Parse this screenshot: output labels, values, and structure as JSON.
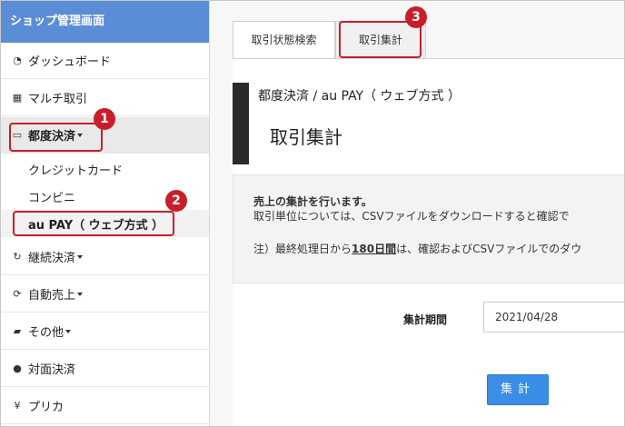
{
  "sidebar": {
    "title": "ショップ管理画面",
    "items": [
      {
        "icon": "dashboard-icon",
        "label": "ダッシュボード",
        "glyph": "◔"
      },
      {
        "icon": "grid-icon",
        "label": "マルチ取引",
        "glyph": "▦"
      },
      {
        "icon": "card-icon",
        "label": "都度決済",
        "glyph": "▭"
      },
      {
        "icon": "refresh-icon",
        "label": "継続決済",
        "glyph": "↻"
      },
      {
        "icon": "sync-icon",
        "label": "自動売上",
        "glyph": "⟳"
      },
      {
        "icon": "folder-icon",
        "label": "その他",
        "glyph": "▰"
      },
      {
        "icon": "user-icon",
        "label": "対面決済",
        "glyph": "●"
      },
      {
        "icon": "yen-icon",
        "label": "プリカ",
        "glyph": "¥"
      }
    ],
    "sub_items": [
      "クレジットカード",
      "コンビニ",
      "au PAY（ ウェブ方式 ）"
    ]
  },
  "tabs": [
    "取引状態検索",
    "取引集計"
  ],
  "page": {
    "subtitle": "都度決済 / au PAY（ ウェブ方式 ）",
    "title": "取引集計"
  },
  "info": {
    "line1": "売上の集計を行います。",
    "line2": "取引単位については、CSVファイルをダウンロードすると確認で",
    "line3_pre": "注）最終処理日から",
    "line3_em": "180日間",
    "line3_post": "は、確認およびCSVファイルでのダウ"
  },
  "form": {
    "period_label": "集計期間",
    "period_value": "2021/04/28",
    "submit_label": "集計"
  },
  "callouts": [
    "1",
    "2",
    "3"
  ],
  "colors": {
    "accent": "#5b8dd6",
    "callout": "#c81e2a",
    "button": "#3a8ee6"
  }
}
